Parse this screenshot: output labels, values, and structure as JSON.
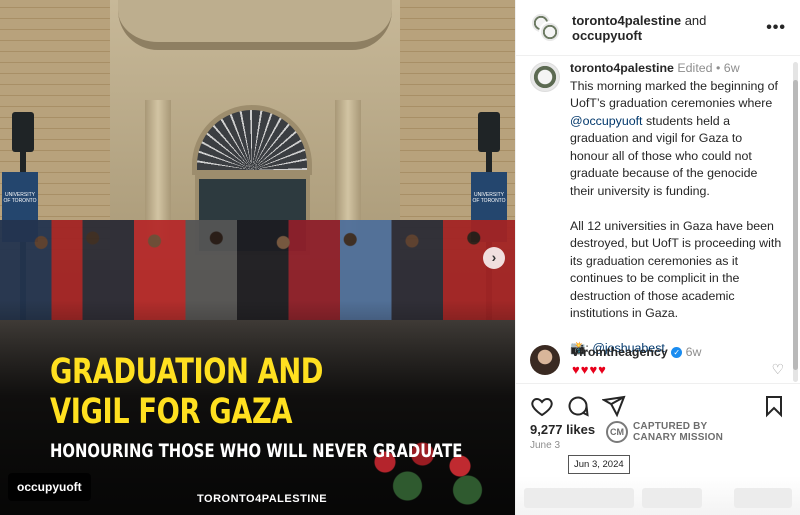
{
  "media": {
    "headline_line1": "GRADUATION AND",
    "headline_line2": "VIGIL FOR GAZA",
    "subline": "HONOURING THOSE WHO WILL NEVER GRADUATE",
    "brand": "TORONTO4PALESTINE",
    "tagged_user": "occupyuoft",
    "banner_text": "UNIVERSITY OF TORONTO",
    "next_icon": "chevron-right-icon"
  },
  "header": {
    "user1": "toronto4palestine",
    "joiner": "and",
    "user2": "occupyuoft",
    "more_icon": "more-horizontal-icon"
  },
  "caption": {
    "username": "toronto4palestine",
    "edited": "Edited",
    "dot": "•",
    "age": "6w",
    "para1_pre": "This morning marked the beginning of UofT’s graduation ceremonies where ",
    "para1_mention": "@occupyuoft",
    "para1_post": " students held a graduation and vigil for Gaza to honour all of those who could not graduate because of the genocide their university is funding.",
    "para2": "All 12 universities in Gaza have been destroyed, but UofT is proceeding with its graduation ceremonies as it continues to be complicit in the destruction of those academic institutions in Gaza.",
    "credit_emoji": "📸:",
    "credit_mention": "@joshuabest"
  },
  "comment": {
    "username": "vfromtheagency",
    "age": "6w",
    "hearts": "♥♥♥♥"
  },
  "actions": {
    "likes": "9,277 likes",
    "date": "June 3",
    "tooltip_date": "Jun 3, 2024",
    "captured_line1": "CAPTURED BY",
    "captured_line2": "CANARY MISSION",
    "captured_logo": "CM"
  }
}
